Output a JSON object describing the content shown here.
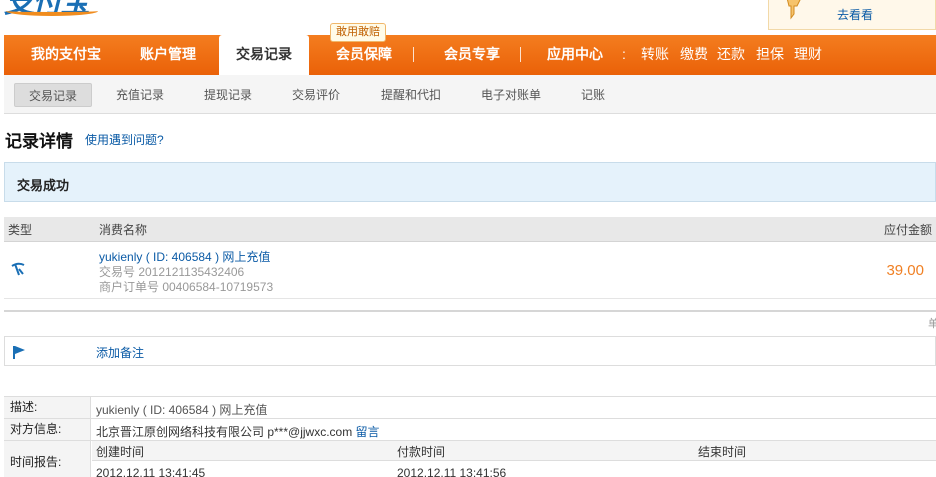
{
  "header": {
    "logo_text": "支付宝",
    "promo_link": "去看看",
    "badge": "敢用敢赔"
  },
  "mainnav": {
    "items": [
      "我的支付宝",
      "账户管理",
      "交易记录",
      "会员保障",
      "会员专享",
      "应用中心"
    ],
    "active": "交易记录",
    "quick": [
      "转账",
      "缴费",
      "还款",
      "担保",
      "理财"
    ]
  },
  "subnav": {
    "items": [
      "交易记录",
      "充值记录",
      "提现记录",
      "交易评价",
      "提醒和代扣",
      "电子对账单",
      "记账"
    ],
    "active": "交易记录"
  },
  "page": {
    "title": "记录详情",
    "help_link": "使用遇到问题?"
  },
  "status": "交易成功",
  "table": {
    "headers": [
      "类型",
      "消费名称",
      "应付金额"
    ],
    "row": {
      "title": "yukienly ( ID: 406584 ) 网上充值",
      "trade_no": "交易号 2012121135432406",
      "order_no": "商户订单号 00406584-10719573",
      "amount": "39.00"
    }
  },
  "corner_char": "单",
  "note_link": "添加备注",
  "info": {
    "desc_label": "描述:",
    "desc_value": "yukienly ( ID: 406584 ) 网上充值",
    "party_label": "对方信息:",
    "party_value": "北京晋江原创网络科技有限公司 p***@jjwxc.com",
    "party_link": "留言",
    "time_label": "时间报告:",
    "time_headers": [
      "创建时间",
      "付款时间",
      "结束时间"
    ],
    "time_values": [
      "2012.12.11 13:41:45",
      "2012.12.11 13:41:56",
      ""
    ]
  },
  "colors": {
    "nav_orange": "#f26b0f",
    "link_blue": "#0b5ba6",
    "amount_orange": "#f08024",
    "status_bg": "#e5f2fb"
  }
}
